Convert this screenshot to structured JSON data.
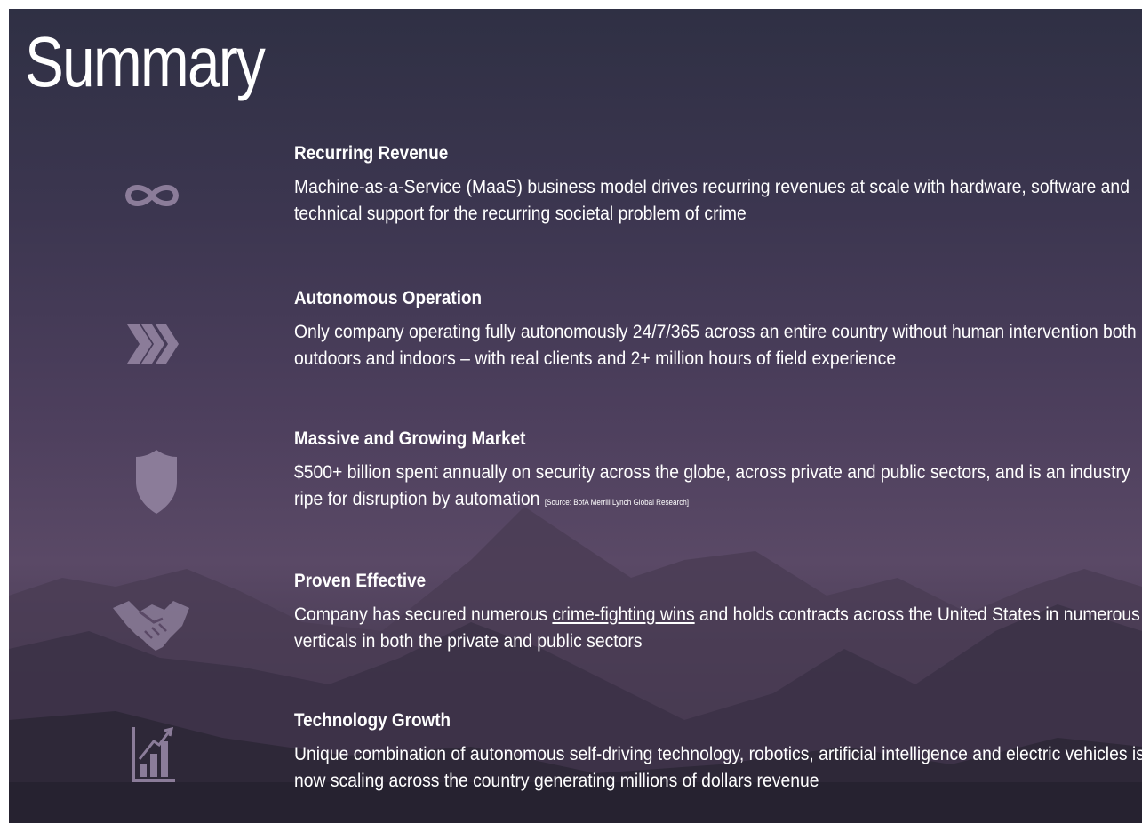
{
  "slide": {
    "title": "Summary"
  },
  "items": [
    {
      "icon": "infinity-icon",
      "heading": "Recurring Revenue",
      "body": "Machine-as-a-Service (MaaS) business model drives recurring revenues at scale with hardware, software and technical support for the recurring societal problem of crime"
    },
    {
      "icon": "triple-chevron-right-icon",
      "heading": "Autonomous Operation",
      "body": "Only company operating fully autonomously 24/7/365 across an entire country without human intervention both outdoors and indoors – with real clients and 2+ million hours of field experience"
    },
    {
      "icon": "shield-icon",
      "heading": "Massive and Growing Market",
      "body": "$500+ billion spent annually on security across the globe, across private and public sectors, and is an industry ripe for disruption by automation",
      "source": "[Source: BofA Merrill Lynch Global Research]"
    },
    {
      "icon": "handshake-icon",
      "heading": "Proven Effective",
      "body_before": "Company has secured numerous ",
      "link": "crime-fighting wins",
      "body_after": " and holds contracts across the United States in numerous verticals in both the private and public sectors"
    },
    {
      "icon": "growth-chart-icon",
      "heading": "Technology Growth",
      "body": "Unique combination of autonomous self-driving technology, robotics, artificial intelligence and electric vehicles is now scaling across the country generating millions of dollars revenue"
    }
  ],
  "colors": {
    "icon": "#8b7c99",
    "text": "#ffffff",
    "background_top": "#2f3044",
    "background_mid": "#4d3f5d"
  }
}
